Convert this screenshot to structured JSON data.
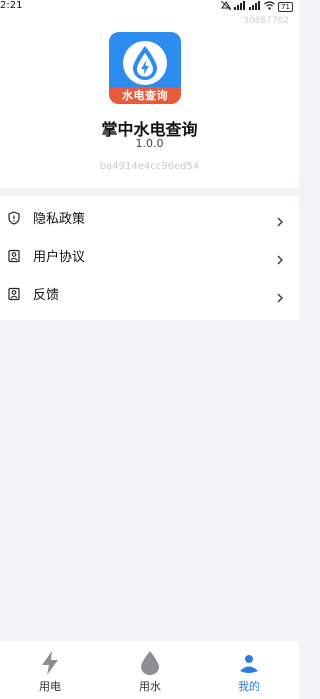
{
  "status_bar": {
    "time": "2:21",
    "battery": "71",
    "icons": [
      "mute-icon",
      "signal-icon",
      "signal-icon",
      "wifi-icon",
      "battery-icon"
    ]
  },
  "watermark": "30887782",
  "app": {
    "logo_text": "水电查询",
    "name": "掌中水电查询",
    "version": "1.0.0",
    "device_id": "ba4914e4cc96ed54"
  },
  "menu": {
    "items": [
      {
        "label": "隐私政策",
        "icon": "shield-icon"
      },
      {
        "label": "用户协议",
        "icon": "user-card-icon"
      },
      {
        "label": "反馈",
        "icon": "user-card-icon"
      }
    ]
  },
  "tabbar": {
    "tabs": [
      {
        "label": "用电",
        "icon": "lightning-icon",
        "active": false
      },
      {
        "label": "用水",
        "icon": "water-drop-icon",
        "active": false
      },
      {
        "label": "我的",
        "icon": "profile-icon",
        "active": true
      }
    ],
    "colors": {
      "active": "#2d7be5",
      "inactive": "#333333"
    }
  },
  "colors": {
    "brand_blue": "#2d8cf0",
    "banner_red": "#e85a3c",
    "background": "#f2f3f7"
  }
}
